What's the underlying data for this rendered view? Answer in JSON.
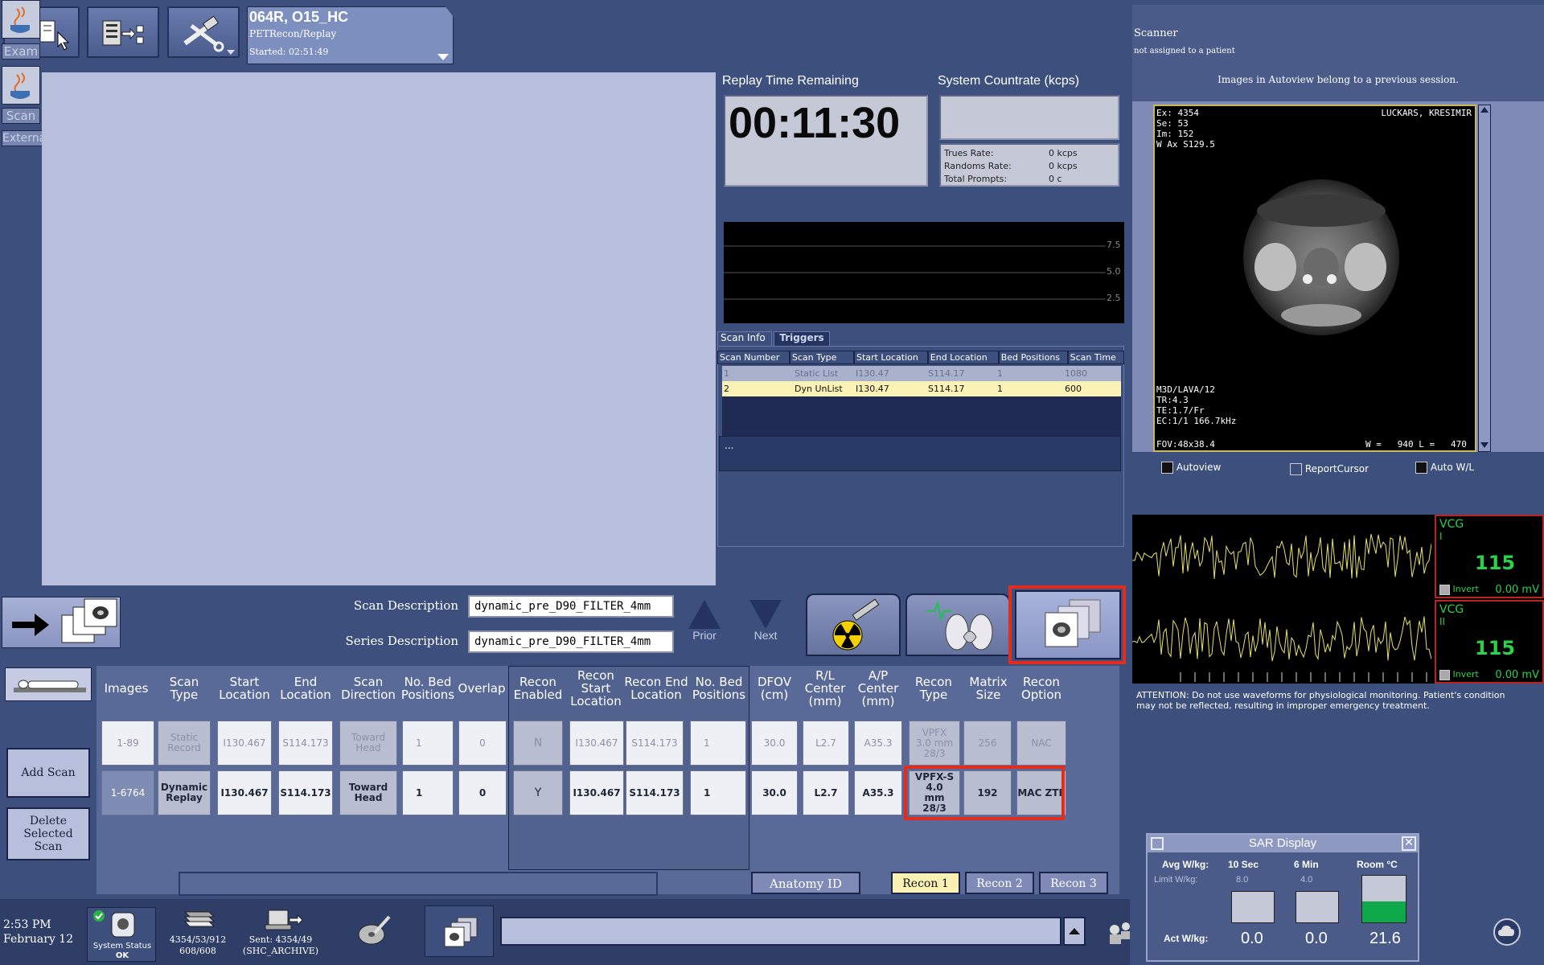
{
  "topbar": {
    "exam_title": "064R, O15_HC",
    "exam_subtitle": "PETRecon/Replay",
    "exam_started": "Started: 02:51:49"
  },
  "sidebar": {
    "exam_label": "Exam",
    "scan_label": "Scan",
    "external_label": "Externa"
  },
  "status_panel": {
    "replay_title": "Replay Time Remaining",
    "replay_time": "00:11:30",
    "countrate_title": "System Countrate (kcps)",
    "trues_label": "Trues Rate:",
    "trues_value": "0 kcps",
    "randoms_label": "Randoms Rate:",
    "randoms_value": "0 kcps",
    "prompts_label": "Total Prompts:",
    "prompts_value": "0 c",
    "graph_ticks": [
      "7.5",
      "5.0",
      "2.5"
    ],
    "tabs": [
      "Scan Info",
      "Triggers"
    ],
    "scan_table_headers": [
      "Scan Number",
      "Scan Type",
      "Start Location",
      "End Location",
      "Bed Positions",
      "Scan Time"
    ],
    "scan_table_rows": [
      [
        "1",
        "Static List",
        "I130.47",
        "S114.17",
        "1",
        "1080"
      ],
      [
        "2",
        "Dyn UnList",
        "I130.47",
        "S114.17",
        "1",
        "600"
      ]
    ],
    "message": "..."
  },
  "editor": {
    "scan_desc_label": "Scan Description",
    "scan_desc_value": "dynamic_pre_D90_FILTER_4mm",
    "series_desc_label": "Series Description",
    "series_desc_value": "dynamic_pre_D90_FILTER_4mm",
    "prior_label": "Prior",
    "next_label": "Next",
    "add_scan": "Add Scan",
    "delete_scan": "Delete Selected Scan",
    "headers": [
      "Images",
      "Scan Type",
      "Start Location",
      "End Location",
      "Scan Direction",
      "No. Bed Positions",
      "Overlap",
      "Recon Enabled",
      "Recon Start Location",
      "Recon End Location",
      "No. Bed Positions",
      "DFOV (cm)",
      "R/L Center (mm)",
      "A/P Center (mm)",
      "Recon Type",
      "Matrix Size",
      "Recon Option"
    ],
    "rows": [
      [
        "1-89",
        "Static Record",
        "I130.467",
        "S114.173",
        "Toward Head",
        "1",
        "0",
        "N",
        "I130.467",
        "S114.173",
        "1",
        "30.0",
        "L2.7",
        "A35.3",
        "VPFX 3.0 mm 28/3",
        "256",
        "NAC"
      ],
      [
        "1-6764",
        "Dynamic Replay",
        "I130.467",
        "S114.173",
        "Toward Head",
        "1",
        "0",
        "Y",
        "I130.467",
        "S114.173",
        "1",
        "30.0",
        "L2.7",
        "A35.3",
        "VPFX-S 4.0 mm 28/3",
        "192",
        "MAC ZTE"
      ]
    ],
    "anatomy_id": "Anatomy ID",
    "recon_tabs": [
      "Recon 1",
      "Recon 2",
      "Recon 3"
    ]
  },
  "statusbar": {
    "time": "2:53 PM",
    "date": "February 12",
    "system_status_label": "System Status",
    "system_status_value": "OK",
    "images_line1": "4354/53/912",
    "images_line2": "608/608",
    "sent_line1": "Sent: 4354/49",
    "sent_line2": "(SHC_ARCHIVE)"
  },
  "right": {
    "scanner_title": "Scanner",
    "scanner_subtitle": "not assigned to a patient",
    "autoview_notice": "Images in Autoview belong to a previous session.",
    "overlay_tl": [
      "Ex: 4354",
      "Se: 53",
      "Im: 152",
      "W Ax S129.5"
    ],
    "overlay_tr": "LUCKARS, KRESIMIR",
    "overlay_bl": [
      "M3D/LAVA/12",
      "TR:4.3",
      "TE:1.7/Fr",
      "EC:1/1 166.7kHz"
    ],
    "overlay_fov": "FOV:48x38.4",
    "overlay_wl": "W =   940 L =   470",
    "chk_autoview": "Autoview",
    "chk_reportcursor": "ReportCursor",
    "chk_autowl": "Auto W/L",
    "vcg1_label": "VCG",
    "vcg1_lead": "I",
    "vcg1_value": "115",
    "vcg1_invert": "Invert",
    "vcg1_mv": "0.00 mV",
    "vcg2_label": "VCG",
    "vcg2_lead": "II",
    "vcg2_value": "115",
    "vcg2_invert": "Invert",
    "vcg2_mv": "0.00 mV",
    "attention": "ATTENTION: Do not use waveforms for physiological monitoring. Patient's condition may not be reflected, resulting in improper emergency treatment."
  },
  "sar": {
    "title": "SAR Display",
    "avg_label": "Avg W/kg:",
    "limit_label": "Limit W/kg:",
    "act_label": "Act W/kg:",
    "col_10sec": "10 Sec",
    "col_6min": "6 Min",
    "col_room": "Room °C",
    "limit_10sec": "8.0",
    "limit_6min": "4.0",
    "act_10sec": "0.0",
    "act_6min": "0.0",
    "room_temp": "21.6"
  }
}
